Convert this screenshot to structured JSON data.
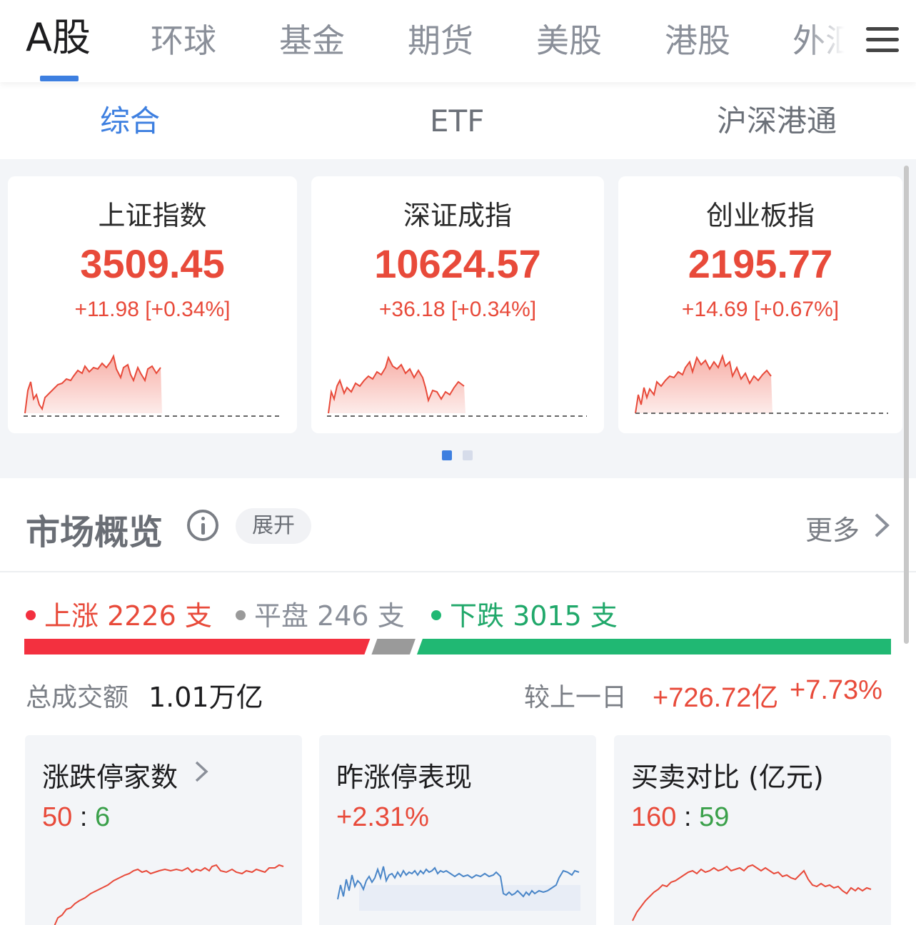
{
  "top_tabs": [
    {
      "label": "A股",
      "active": true
    },
    {
      "label": "环球"
    },
    {
      "label": "基金"
    },
    {
      "label": "期货"
    },
    {
      "label": "美股"
    },
    {
      "label": "港股"
    },
    {
      "label": "外汇"
    }
  ],
  "sub_tabs": [
    {
      "label": "综合",
      "active": true
    },
    {
      "label": "ETF"
    },
    {
      "label": "沪深港通"
    }
  ],
  "indices": [
    {
      "name": "上证指数",
      "value": "3509.45",
      "change": "+11.98 [+0.34%]"
    },
    {
      "name": "深证成指",
      "value": "10624.57",
      "change": "+36.18 [+0.34%]"
    },
    {
      "name": "创业板指",
      "value": "2195.77",
      "change": "+14.69 [+0.67%]"
    }
  ],
  "carousel": {
    "pages": 2,
    "active_page": 1
  },
  "market_overview": {
    "title": "市场概览",
    "expand_label": "展开",
    "more_label": "更多"
  },
  "breadth": {
    "up_label": "上涨 2226 支",
    "flat_label": "平盘 246 支",
    "down_label": "下跌 3015 支",
    "up_count": 2226,
    "flat_count": 246,
    "down_count": 3015
  },
  "turnover": {
    "label": "总成交额",
    "value": "1.01万亿",
    "compare_label": "较上一日",
    "compare_amount": "+726.72亿",
    "compare_pct": "+7.73%"
  },
  "stat_cards": [
    {
      "title": "涨跌停家数",
      "value_a": "50",
      "sep": ":",
      "value_b": "6"
    },
    {
      "title": "昨涨停表现",
      "value": "+2.31%"
    },
    {
      "title": "买卖对比 (亿元)",
      "value_a": "160",
      "sep": ":",
      "value_b": "59"
    }
  ],
  "colors": {
    "accent": "#3d7fe0",
    "up": "#e84a3a",
    "down": "#3aa04a",
    "up_bar": "#f3303f",
    "flat_bar": "#9a9a9a",
    "down_bar": "#20b873"
  }
}
